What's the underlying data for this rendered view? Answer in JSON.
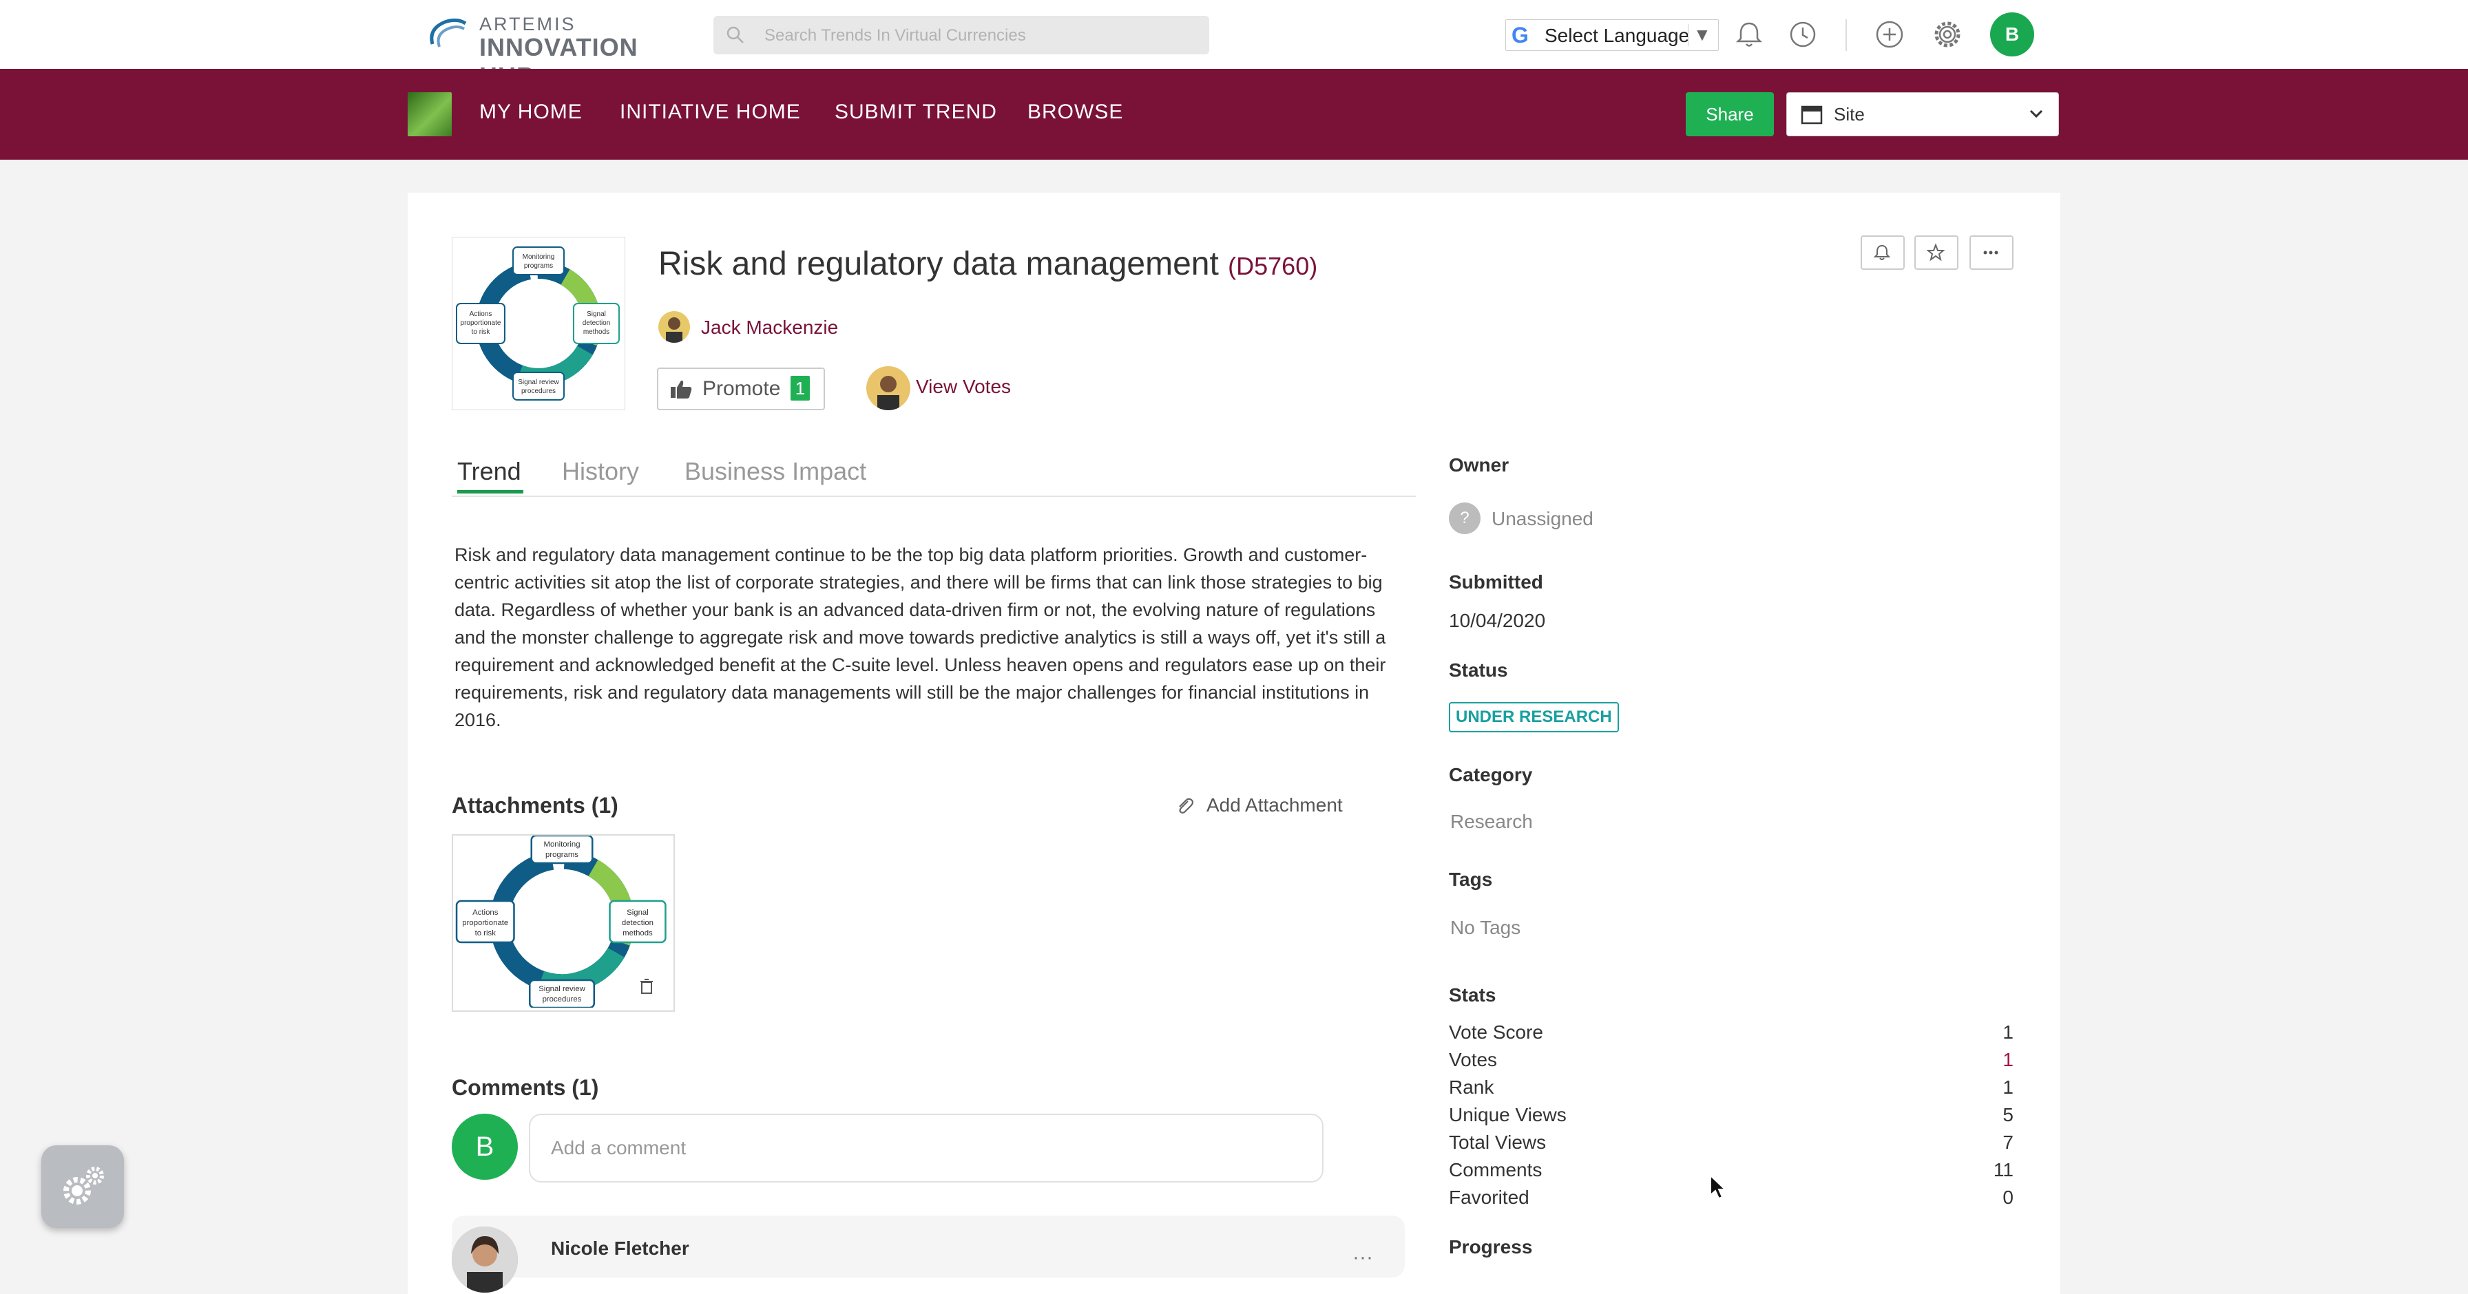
{
  "header": {
    "logo_line1": "ARTEMIS",
    "logo_line2": "INNOVATION HUB",
    "search_placeholder": "Search Trends In Virtual Currencies",
    "language_label": "Select Language",
    "user_initial": "B"
  },
  "nav": {
    "items": [
      "MY HOME",
      "INITIATIVE HOME",
      "SUBMIT TREND",
      "BROWSE"
    ],
    "share_label": "Share",
    "site_label": "Site"
  },
  "trend": {
    "title": "Risk and regulatory data management",
    "code": "(D5760)",
    "author": "Jack Mackenzie",
    "promote_label": "Promote",
    "promote_count": "1",
    "view_votes_label": "View Votes"
  },
  "tabs": [
    "Trend",
    "History",
    "Business Impact"
  ],
  "description": "Risk and regulatory data management continue to be the top big data platform priorities. Growth and customer-centric activities sit atop the list of corporate strategies, and there will be firms that can link those strategies to big data. Regardless of whether your bank is an advanced data-driven firm or not, the evolving nature of regulations and the monster challenge to aggregate risk and move towards predictive analytics is still a ways off, yet it's still a requirement and acknowledged benefit at the C-suite level. Unless heaven opens and regulators ease up on their requirements, risk and regulatory data managements will still be the major challenges for financial institutions in 2016.",
  "diagram": {
    "top": [
      "Monitoring",
      "programs"
    ],
    "right": [
      "Signal",
      "detection",
      "methods"
    ],
    "bottom": [
      "Signal review",
      "procedures"
    ],
    "left": [
      "Actions",
      "proportionate",
      "to risk"
    ]
  },
  "attachments": {
    "heading": "Attachments (1)",
    "add_label": "Add Attachment"
  },
  "comments": {
    "heading": "Comments (1)",
    "input_placeholder": "Add a comment",
    "user_initial": "B",
    "first_author": "Nicole Fletcher"
  },
  "sidebar": {
    "owner_label": "Owner",
    "owner_value": "Unassigned",
    "submitted_label": "Submitted",
    "submitted_value": "10/04/2020",
    "status_label": "Status",
    "status_value": "UNDER RESEARCH",
    "category_label": "Category",
    "category_value": "Research",
    "tags_label": "Tags",
    "tags_value": "No Tags",
    "stats_label": "Stats",
    "stats": [
      {
        "label": "Vote Score",
        "value": "1"
      },
      {
        "label": "Votes",
        "value": "1"
      },
      {
        "label": "Rank",
        "value": "1"
      },
      {
        "label": "Unique Views",
        "value": "5"
      },
      {
        "label": "Total Views",
        "value": "7"
      },
      {
        "label": "Comments",
        "value": "11"
      },
      {
        "label": "Favorited",
        "value": "0"
      }
    ],
    "progress_label": "Progress"
  },
  "colors": {
    "brand": "#7a1238",
    "accent_green": "#1fb054",
    "status_teal": "#19a0a0"
  }
}
